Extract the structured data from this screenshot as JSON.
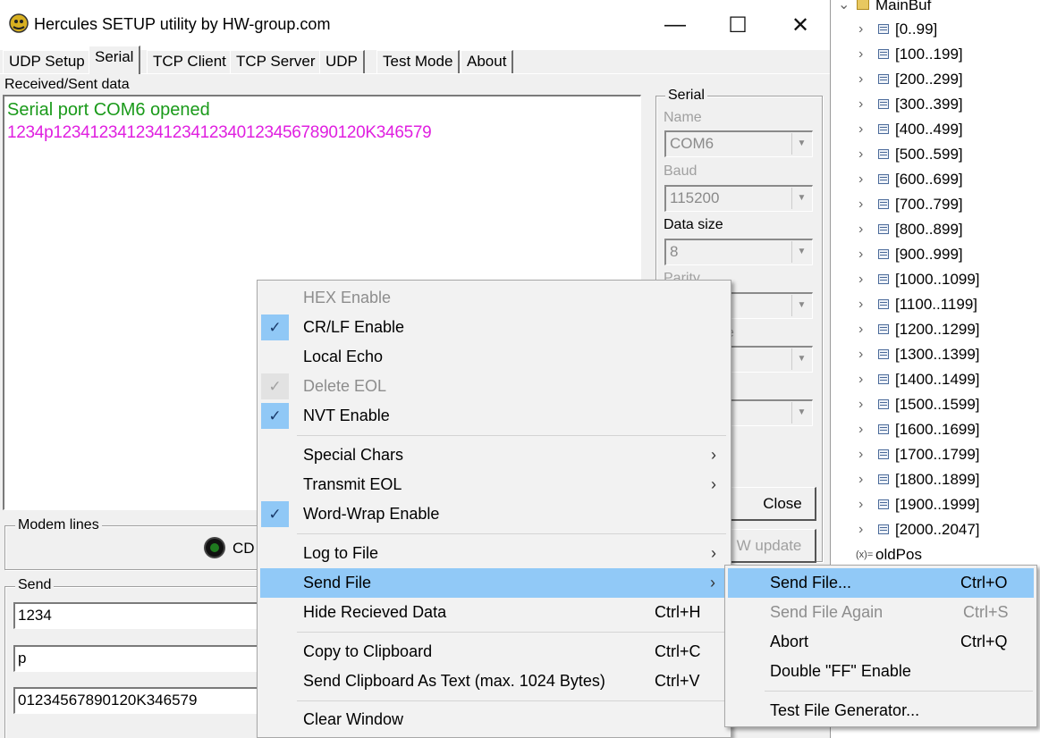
{
  "window": {
    "title": "Hercules SETUP utility by HW-group.com",
    "minimize": "—",
    "maximize": "☐",
    "close": "✕"
  },
  "tabs": [
    "UDP Setup",
    "Serial",
    "TCP Client",
    "TCP Server",
    "UDP",
    "Test Mode",
    "About"
  ],
  "active_tab": "Serial",
  "received": {
    "label": "Received/Sent data",
    "line1": "Serial port COM6 opened",
    "line2": "1234p1234123412341234123401234567890120K346579",
    "line1_color": "#1a9a1a",
    "line2_color": "#e020e0"
  },
  "serial": {
    "group": "Serial",
    "name_label": "Name",
    "name_value": "COM6",
    "baud_label": "Baud",
    "baud_value": "115200",
    "datasize_label": "Data size",
    "datasize_value": "8",
    "parity_label": "Parity",
    "partial_label": "e",
    "close_button": "Close",
    "hw_update_button": "W update"
  },
  "modem": {
    "group": "Modem lines",
    "cd_label": "CD"
  },
  "send": {
    "group": "Send",
    "inputs": [
      "1234",
      "p",
      "01234567890120K346579"
    ]
  },
  "tree": {
    "root": "MainBuf",
    "items": [
      "[0..99]",
      "[100..199]",
      "[200..299]",
      "[300..399]",
      "[400..499]",
      "[500..599]",
      "[600..699]",
      "[700..799]",
      "[800..899]",
      "[900..999]",
      "[1000..1099]",
      "[1100..1199]",
      "[1200..1299]",
      "[1300..1399]",
      "[1400..1499]",
      "[1500..1599]",
      "[1600..1699]",
      "[1700..1799]",
      "[1800..1899]",
      "[1900..1999]",
      "[2000..2047]"
    ],
    "last_label": "oldPos",
    "last_icon_text": "(x)="
  },
  "context_menu": {
    "hex_enable": "HEX Enable",
    "crlf_enable": "CR/LF Enable",
    "local_echo": "Local Echo",
    "delete_eol": "Delete EOL",
    "nvt_enable": "NVT Enable",
    "special_chars": "Special Chars",
    "transmit_eol": "Transmit EOL",
    "word_wrap": "Word-Wrap Enable",
    "log_to_file": "Log to File",
    "send_file": "Send File",
    "hide_received": "Hide Recieved Data",
    "hide_received_shortcut": "Ctrl+H",
    "copy_clipboard": "Copy to Clipboard",
    "copy_clipboard_shortcut": "Ctrl+C",
    "send_clipboard": "Send Clipboard As Text (max. 1024 Bytes)",
    "send_clipboard_shortcut": "Ctrl+V",
    "clear_window": "Clear Window",
    "check_glyph": "✓",
    "submenu_glyph": "›"
  },
  "submenu": {
    "send_file": "Send File...",
    "send_file_shortcut": "Ctrl+O",
    "send_again": "Send File Again",
    "send_again_shortcut": "Ctrl+S",
    "abort": "Abort",
    "abort_shortcut": "Ctrl+Q",
    "double_ff": "Double \"FF\" Enable",
    "test_gen": "Test File Generator..."
  },
  "colors": {
    "menu_highlight": "#91c9f7",
    "check_bg": "#90c8f6"
  }
}
